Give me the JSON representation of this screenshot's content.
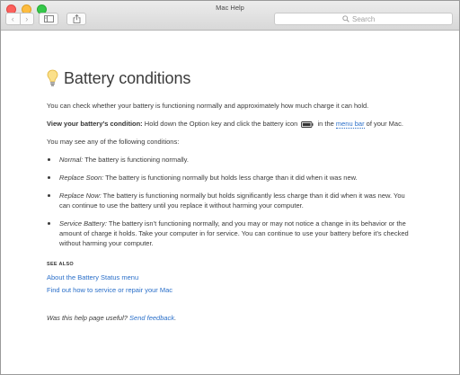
{
  "window": {
    "title": "Mac Help"
  },
  "toolbar": {
    "back_glyph": "‹",
    "forward_glyph": "›",
    "search_placeholder": "Search"
  },
  "article": {
    "title": "Battery conditions",
    "intro": "You can check whether your battery is functioning normally and approximately how much charge it can hold.",
    "view_condition": {
      "label": "View your battery’s condition:",
      "text_before": " Hold down the Option key and click the battery icon ",
      "text_middle": " in the ",
      "link": "menu bar",
      "text_after": " of your Mac."
    },
    "conditions_intro": "You may see any of the following conditions:",
    "conditions": [
      {
        "term": "Normal:",
        "text": " The battery is functioning normally."
      },
      {
        "term": "Replace Soon:",
        "text": " The battery is functioning normally but holds less charge than it did when it was new."
      },
      {
        "term": "Replace Now:",
        "text": " The battery is functioning normally but holds significantly less charge than it did when it was new. You can continue to use the battery until you replace it without harming your computer."
      },
      {
        "term": "Service Battery:",
        "text": " The battery isn’t functioning normally, and you may or may not notice a change in its behavior or the amount of charge it holds. Take your computer in for service. You can continue to use your battery before it’s checked without harming your computer."
      }
    ],
    "see_also": {
      "heading": "SEE ALSO",
      "links": [
        "About the Battery Status menu",
        "Find out how to service or repair your Mac"
      ]
    },
    "feedback": {
      "question": "Was this help page useful? ",
      "link": "Send feedback",
      "period": "."
    }
  }
}
